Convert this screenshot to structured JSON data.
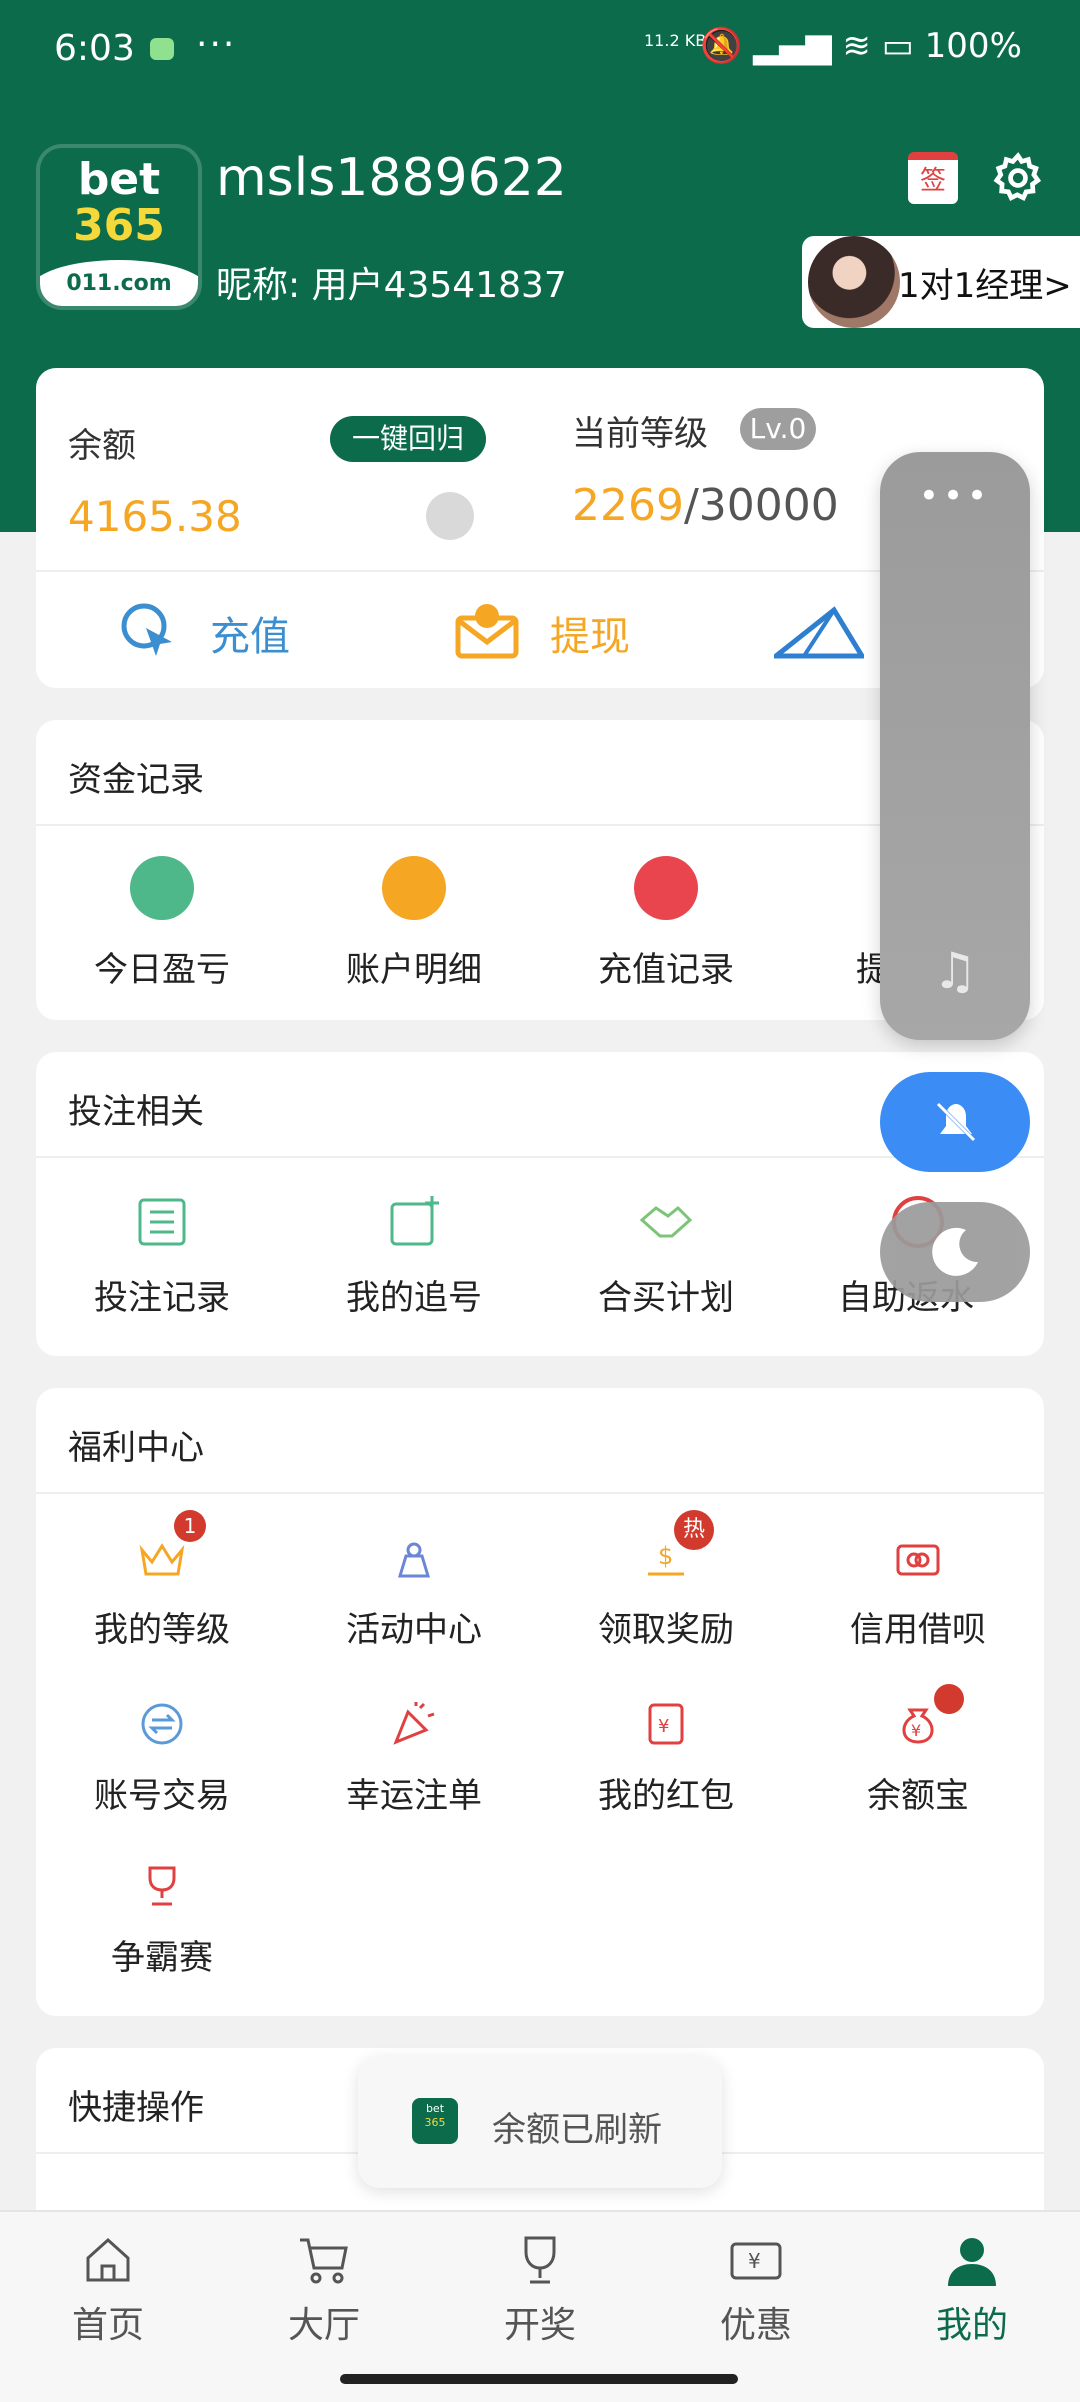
{
  "status_bar": {
    "time": "6:03",
    "speed": "11.2 KB/s",
    "battery": "100%"
  },
  "profile": {
    "logo_top": "bet",
    "logo_mid": "365",
    "logo_bottom": "011.com",
    "username": "msls1889622",
    "nickname": "昵称: 用户43541837",
    "sign_char": "签",
    "manager_label": "1对1经理>"
  },
  "account": {
    "balance_label": "余额",
    "return_button": "一键回归",
    "balance_value": "4165.38",
    "level_label": "当前等级",
    "level_badge": "Lv.0",
    "level_current": "2269",
    "level_total": "/30000",
    "actions": [
      {
        "label": "充值"
      },
      {
        "label": "提现"
      }
    ]
  },
  "sections": {
    "funds": {
      "title": "资金记录",
      "items": [
        {
          "label": "今日盈亏"
        },
        {
          "label": "账户明细"
        },
        {
          "label": "充值记录"
        },
        {
          "label": "提"
        }
      ]
    },
    "betting": {
      "title": "投注相关",
      "items": [
        {
          "label": "投注记录"
        },
        {
          "label": "我的追号"
        },
        {
          "label": "合买计划"
        },
        {
          "label": "自助返水"
        }
      ]
    },
    "welfare": {
      "title": "福利中心",
      "badge_level": "1",
      "badge_hot": "热",
      "items": [
        {
          "label": "我的等级"
        },
        {
          "label": "活动中心"
        },
        {
          "label": "领取奖励"
        },
        {
          "label": "信用借呗"
        },
        {
          "label": "账号交易"
        },
        {
          "label": "幸运注单"
        },
        {
          "label": "我的红包"
        },
        {
          "label": "余额宝"
        },
        {
          "label": "争霸赛"
        }
      ]
    },
    "quick": {
      "title": "快捷操作"
    }
  },
  "toast": {
    "text": "余额已刷新"
  },
  "bottom_nav": {
    "items": [
      {
        "label": "首页"
      },
      {
        "label": "大厅"
      },
      {
        "label": "开奖"
      },
      {
        "label": "优惠"
      },
      {
        "label": "我的"
      }
    ],
    "active_color": "#0b6b4a"
  },
  "colors": {
    "brand": "#0b6b4a",
    "accent": "#f5a623",
    "float_blue": "#3b8cf5"
  }
}
